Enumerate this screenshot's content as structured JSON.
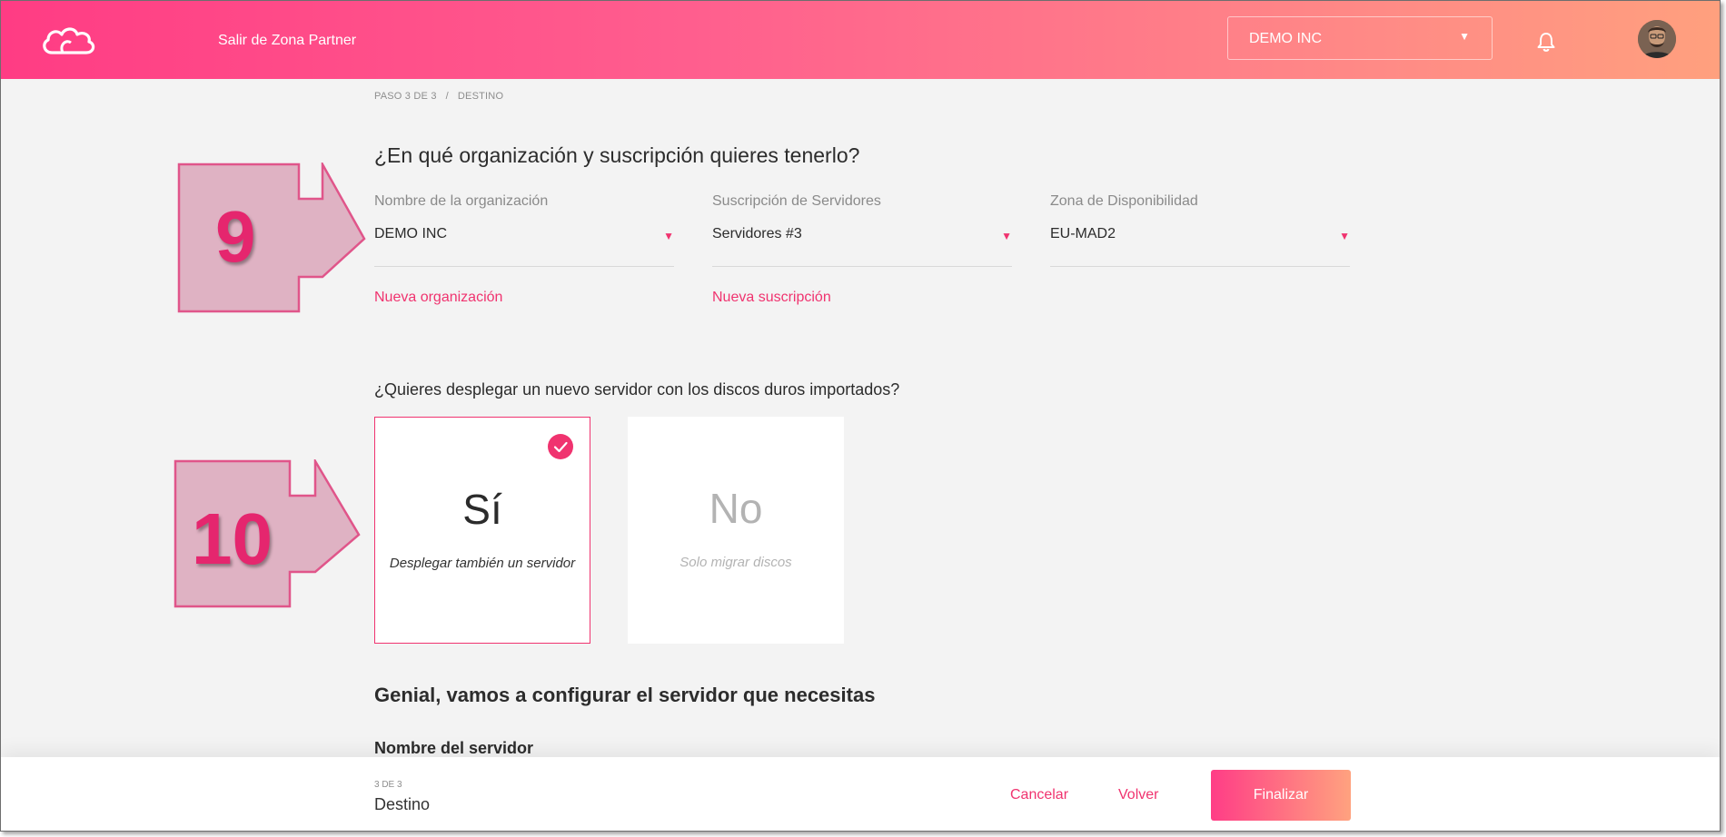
{
  "header": {
    "exit_link": "Salir de Zona Partner",
    "org_select_value": "DEMO INC",
    "icons": [
      "cloud-logo-icon",
      "chevron-down-icon",
      "bell-icon",
      "user-avatar"
    ]
  },
  "breadcrumb": {
    "step": "PASO 3 DE 3",
    "separator": "/",
    "current": "DESTINO"
  },
  "org_section": {
    "title": "¿En qué organización y suscripción quieres tenerlo?",
    "fields": [
      {
        "label": "Nombre de la organización",
        "value": "DEMO INC",
        "link": "Nueva organización"
      },
      {
        "label": "Suscripción de Servidores",
        "value": "Servidores #3",
        "link": "Nueva suscripción"
      },
      {
        "label": "Zona de Disponibilidad",
        "value": "EU-MAD2"
      }
    ]
  },
  "deploy_section": {
    "title": "¿Quieres desplegar un nuevo servidor con los discos duros importados?",
    "options": [
      {
        "title": "Sí",
        "subtitle": "Desplegar también un servidor",
        "selected": true
      },
      {
        "title": "No",
        "subtitle": "Solo migrar discos",
        "selected": false
      }
    ]
  },
  "config_section": {
    "title": "Genial, vamos a configurar el servidor que necesitas",
    "server_name_label": "Nombre del servidor"
  },
  "annotations": {
    "first": "9",
    "second": "10"
  },
  "footer": {
    "step_small": "3 DE 3",
    "step_name": "Destino",
    "cancel": "Cancelar",
    "back": "Volver",
    "finish": "Finalizar"
  },
  "colors": {
    "accent": "#f0336f",
    "gradient_start": "#ff3c84",
    "gradient_end": "#ffa07e",
    "callout_fill": "#e2b3c4"
  }
}
